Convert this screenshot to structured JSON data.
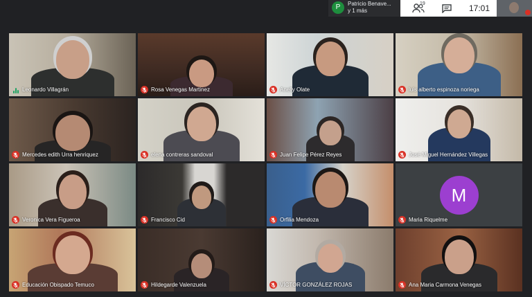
{
  "presenter": {
    "initial": "P",
    "name": "Patricio Benave...",
    "more": "y 1 más"
  },
  "controls": {
    "participants_count": "19",
    "clock": "17:01"
  },
  "participants": [
    {
      "name": "Leonardo Villagrán",
      "muted": false,
      "speaking": true
    },
    {
      "name": "Rosa Venegas Martinez",
      "muted": true
    },
    {
      "name": "Anelly Olate",
      "muted": true
    },
    {
      "name": "luis alberto espinoza noriega",
      "muted": true
    },
    {
      "name": "Mercedes edith Urra henriquez",
      "muted": true
    },
    {
      "name": "elena contreras sandoval",
      "muted": true
    },
    {
      "name": "Juan Felipe Pérez Reyes",
      "muted": true
    },
    {
      "name": "José Miguel Hernández Villegas",
      "muted": true
    },
    {
      "name": "Veronica Vera Figueroa",
      "muted": true
    },
    {
      "name": "Francisco Cid",
      "muted": true
    },
    {
      "name": "Orfilia Mendoza",
      "muted": true
    },
    {
      "name": "Maria Riquelme",
      "muted": true,
      "avatar": "M"
    },
    {
      "name": "Educación Obispado Temuco",
      "muted": true
    },
    {
      "name": "Hildegarde Valenzuela",
      "muted": true
    },
    {
      "name": "VÍCTOR GONZÁLEZ ROJAS",
      "muted": true
    },
    {
      "name": "Ana Maria Carmona Venegas",
      "muted": true
    }
  ],
  "colors": {
    "mic_off": "#d93025",
    "speaking": "#1ea362",
    "avatar_m": "#9c3fd0"
  }
}
